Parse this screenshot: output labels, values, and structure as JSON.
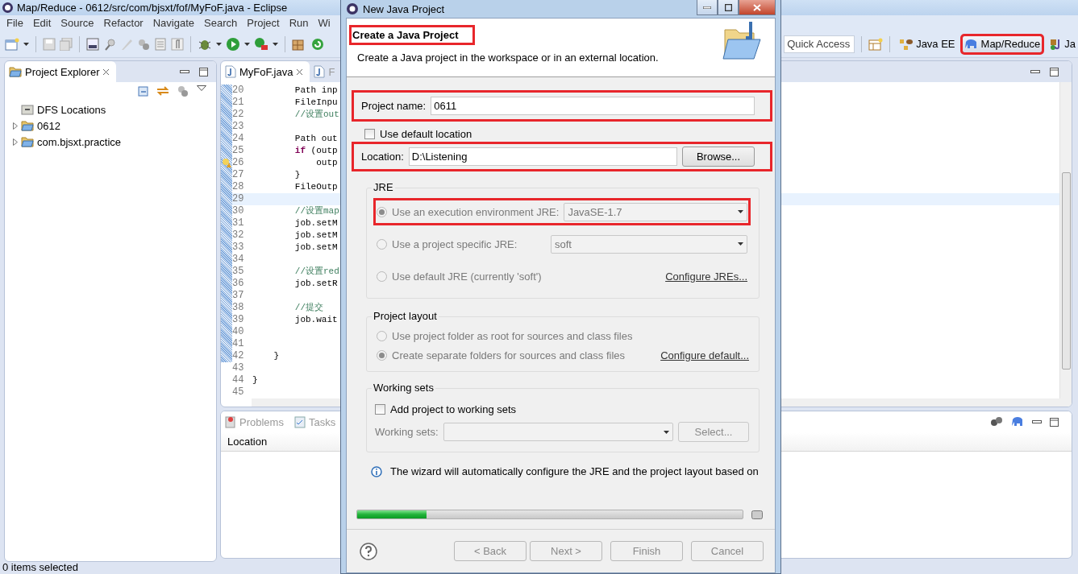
{
  "window": {
    "title": "Map/Reduce - 0612/src/com/bjsxt/fof/MyFoF.java - Eclipse"
  },
  "menu": [
    "File",
    "Edit",
    "Source",
    "Refactor",
    "Navigate",
    "Search",
    "Project",
    "Run",
    "Wi"
  ],
  "quick_access": {
    "placeholder": "Quick Access"
  },
  "perspectives": [
    {
      "label": "Java EE",
      "selected": false,
      "highlighted": false
    },
    {
      "label": "Map/Reduce",
      "selected": true,
      "highlighted": true
    },
    {
      "label": "Ja",
      "selected": false,
      "highlighted": false
    }
  ],
  "project_explorer": {
    "title": "Project Explorer",
    "items": [
      {
        "label": "DFS Locations",
        "expandable": false
      },
      {
        "label": "0612",
        "expandable": true
      },
      {
        "label": "com.bjsxt.practice",
        "expandable": true
      }
    ]
  },
  "editor": {
    "tabs": [
      {
        "label": "MyFoF.java",
        "selected": true
      },
      {
        "label": "F",
        "selected": false
      }
    ],
    "lines": [
      {
        "number": "20",
        "current": false,
        "tokens": [
          {
            "text": "        Path inp",
            "kind": "plain"
          }
        ]
      },
      {
        "number": "21",
        "current": false,
        "tokens": [
          {
            "text": "        FileInpu",
            "kind": "plain"
          }
        ]
      },
      {
        "number": "22",
        "current": false,
        "tokens": [
          {
            "text": "        //设置out",
            "kind": "comment"
          }
        ]
      },
      {
        "number": "23",
        "current": false
      },
      {
        "number": "24",
        "current": false,
        "tokens": [
          {
            "text": "        Path out",
            "kind": "plain"
          }
        ]
      },
      {
        "number": "25",
        "current": false,
        "tokens": [
          {
            "text": "        if",
            "kind": "keyword"
          },
          {
            "text": " (outp",
            "kind": "plain"
          }
        ]
      },
      {
        "number": "26",
        "current": false,
        "warning": true,
        "tokens": [
          {
            "text": "            outp",
            "kind": "plain"
          }
        ]
      },
      {
        "number": "27",
        "current": false,
        "tokens": [
          {
            "text": "        }",
            "kind": "plain"
          }
        ]
      },
      {
        "number": "28",
        "current": false,
        "tokens": [
          {
            "text": "        FileOutp",
            "kind": "plain"
          }
        ]
      },
      {
        "number": "29",
        "current": true
      },
      {
        "number": "30",
        "current": false,
        "tokens": [
          {
            "text": "        //设置map",
            "kind": "comment"
          }
        ]
      },
      {
        "number": "31",
        "current": false,
        "tokens": [
          {
            "text": "        job.setM",
            "kind": "plain"
          }
        ]
      },
      {
        "number": "32",
        "current": false,
        "tokens": [
          {
            "text": "        job.setM",
            "kind": "plain"
          }
        ]
      },
      {
        "number": "33",
        "current": false,
        "tokens": [
          {
            "text": "        job.setM",
            "kind": "plain"
          }
        ]
      },
      {
        "number": "34",
        "current": false
      },
      {
        "number": "35",
        "current": false,
        "tokens": [
          {
            "text": "        //设置red",
            "kind": "comment"
          }
        ]
      },
      {
        "number": "36",
        "current": false,
        "tokens": [
          {
            "text": "        job.setR",
            "kind": "plain"
          }
        ]
      },
      {
        "number": "37",
        "current": false
      },
      {
        "number": "38",
        "current": false,
        "tokens": [
          {
            "text": "        //提交",
            "kind": "comment"
          }
        ]
      },
      {
        "number": "39",
        "current": false,
        "tokens": [
          {
            "text": "        job.wait",
            "kind": "plain"
          }
        ]
      },
      {
        "number": "40",
        "current": false
      },
      {
        "number": "41",
        "current": false
      },
      {
        "number": "42",
        "current": false,
        "tokens": [
          {
            "text": "    }",
            "kind": "plain"
          }
        ]
      },
      {
        "number": "43",
        "current": false
      },
      {
        "number": "44",
        "current": false,
        "tokens": [
          {
            "text": "}",
            "kind": "plain"
          }
        ]
      },
      {
        "number": "45",
        "current": false
      }
    ]
  },
  "bottom_panel": {
    "tabs": [
      "Problems",
      "Tasks"
    ],
    "columns": [
      "Location"
    ]
  },
  "status_bar": "0 items selected",
  "dialog": {
    "title": "New Java Project",
    "heading": "Create a Java Project",
    "heading_highlighted": true,
    "description": "Create a Java project in the workspace or in an external location.",
    "project_name": {
      "label": "Project name:",
      "value": "0611",
      "highlighted": true
    },
    "use_default_location": {
      "label": "Use default location",
      "checked": false
    },
    "location": {
      "label": "Location:",
      "value": "D:\\Listening",
      "button": "Browse...",
      "highlighted": true
    },
    "jre": {
      "title": "JRE",
      "options": [
        {
          "kind": "combo",
          "label": "Use an execution environment JRE:",
          "selected": true,
          "disabled": true,
          "value": "JavaSE-1.7",
          "highlighted": true
        },
        {
          "kind": "combo",
          "label": "Use a project specific JRE:",
          "selected": false,
          "disabled": true,
          "value": "soft",
          "highlighted": false
        },
        {
          "kind": "link",
          "label": "Use default JRE (currently 'soft')",
          "selected": false,
          "disabled": true,
          "link": "Configure JREs...",
          "highlighted": false
        }
      ]
    },
    "project_layout": {
      "title": "Project layout",
      "options": [
        {
          "label": "Use project folder as root for sources and class files",
          "selected": false,
          "disabled": true
        },
        {
          "label": "Create separate folders for sources and class files",
          "selected": true,
          "disabled": true,
          "link": "Configure default..."
        }
      ]
    },
    "working_sets": {
      "title": "Working sets",
      "add": {
        "label": "Add project to working sets",
        "checked": false
      },
      "field_label": "Working sets:",
      "button": "Select..."
    },
    "info": "The wizard will automatically configure the JRE and the project layout based on",
    "progress": {
      "level": 0.18
    },
    "buttons": [
      {
        "label": "< Back",
        "disabled": true
      },
      {
        "label": "Next >",
        "disabled": true
      },
      {
        "label": "Finish",
        "disabled": true
      },
      {
        "label": "Cancel",
        "disabled": true
      }
    ]
  }
}
